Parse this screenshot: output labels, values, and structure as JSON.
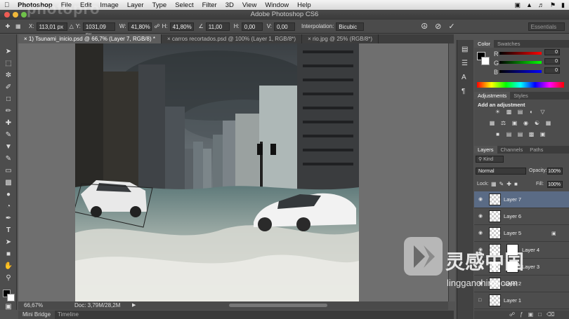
{
  "menubar": {
    "apple_icon": "apple-icon",
    "app_name": "Photoshop",
    "items": [
      "File",
      "Edit",
      "Image",
      "Layer",
      "Type",
      "Select",
      "Filter",
      "3D",
      "View",
      "Window",
      "Help"
    ]
  },
  "titlebar": {
    "title": "Adobe Photoshop CS6"
  },
  "watermark_top": "photopro",
  "options": {
    "x_value": "113,01 px",
    "y_label": "Y:",
    "y_value": "1031,09 px",
    "w_label": "W:",
    "w_value": "41,80%",
    "h_value": "41,80%",
    "angle_value": "11,00",
    "h_skew_label": "H:",
    "h_skew_value": "0,00",
    "v_skew_label": "V:",
    "v_skew_value": "0,00",
    "interp_label": "Interpolation:",
    "interp_value": "Bicubic",
    "workspace_value": "Essentials"
  },
  "tabs": [
    {
      "label": "1) Tsunami_inicio.psd @ 66,7% (Layer 7, RGB/8) *",
      "active": true
    },
    {
      "label": "carros recortados.psd @ 100% (Layer 1, RGB/8*)",
      "active": false
    },
    {
      "label": "rio.jpg @ 25% (RGB/8*)",
      "active": false
    }
  ],
  "status": {
    "zoom": "66,67%",
    "doc": "Doc: 3,79M/28,2M"
  },
  "bottom": {
    "mini_bridge": "Mini Bridge",
    "timeline": "Timeline"
  },
  "color_panel": {
    "tabs": [
      "Color",
      "Swatches"
    ],
    "r_label": "R",
    "g_label": "G",
    "b_label": "B",
    "fg_color": "#000000",
    "bg_color": "#ffffff"
  },
  "adjustments_panel": {
    "tabs": [
      "Adjustments",
      "Styles"
    ],
    "heading": "Add an adjustment"
  },
  "layers_panel": {
    "tabs": [
      "Layers",
      "Channels",
      "Paths"
    ],
    "kind": "Kind",
    "blend_mode": "Normal",
    "opacity_label": "Opacity:",
    "opacity_value": "100%",
    "lock_label": "Lock:",
    "fill_label": "Fill:",
    "fill_value": "100%",
    "layers": [
      {
        "name": "Layer 7",
        "selected": true
      },
      {
        "name": "Layer 6",
        "selected": false
      },
      {
        "name": "Layer 5",
        "selected": false
      },
      {
        "name": "Layer 4",
        "selected": false
      },
      {
        "name": "Layer 3",
        "selected": false
      },
      {
        "name": "Layer 2",
        "selected": false
      },
      {
        "name": "Layer 1",
        "selected": false
      }
    ]
  },
  "watermark": {
    "brand_cn": "灵感中国",
    "site": "lingganchina.com"
  }
}
